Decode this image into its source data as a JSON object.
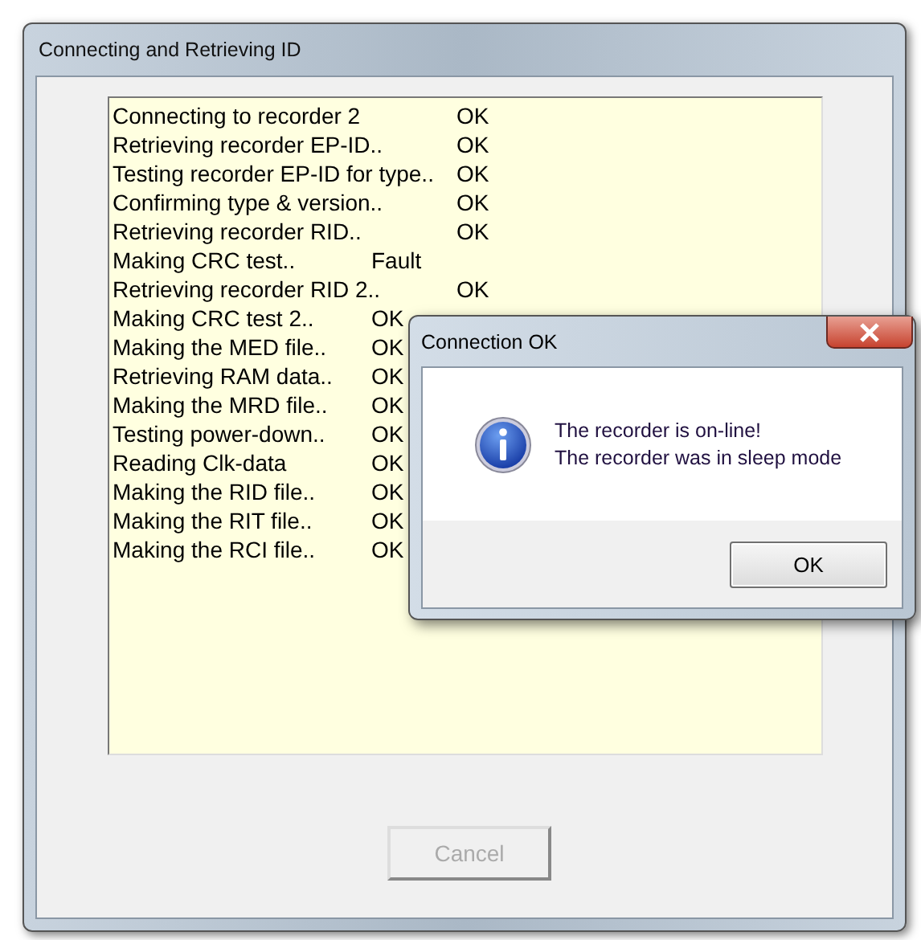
{
  "window": {
    "title": "Connecting and Retrieving ID"
  },
  "log": [
    {
      "label": "Connecting to recorder 2",
      "status": "OK",
      "kind": "wide"
    },
    {
      "label": "Retrieving recorder EP-ID..",
      "status": "OK",
      "kind": "wide"
    },
    {
      "label": "Testing recorder EP-ID for type..",
      "status": "OK",
      "kind": "wide"
    },
    {
      "label": "Confirming type & version..",
      "status": "OK",
      "kind": "wide"
    },
    {
      "label": "Retrieving recorder RID..",
      "status": "OK",
      "kind": "wide"
    },
    {
      "label": "Making CRC test..",
      "status": "Fault",
      "kind": "narrow"
    },
    {
      "label": "Retrieving recorder RID 2..",
      "status": "OK",
      "kind": "wide"
    },
    {
      "label": "Making CRC test 2..",
      "status": "OK",
      "kind": "narrow"
    },
    {
      "label": "Making the MED file..",
      "status": "OK",
      "kind": "narrow"
    },
    {
      "label": "Retrieving RAM data..",
      "status": "OK",
      "kind": "narrow"
    },
    {
      "label": "Making the MRD file..",
      "status": "OK",
      "kind": "narrow"
    },
    {
      "label": "Testing power-down..",
      "status": "OK",
      "kind": "narrow"
    },
    {
      "label": "Reading Clk-data",
      "status": "OK",
      "kind": "narrow"
    },
    {
      "label": "Making the RID file..",
      "status": "OK",
      "kind": "narrow"
    },
    {
      "label": "Making the RIT file..",
      "status": "OK",
      "kind": "narrow"
    },
    {
      "label": "Making the RCI file..",
      "status": "OK",
      "kind": "narrow"
    }
  ],
  "cancel_button": {
    "label": "Cancel",
    "disabled": true
  },
  "dialog": {
    "title": "Connection OK",
    "messages": [
      "The recorder is on-line!",
      "The recorder was in sleep mode"
    ],
    "button": "OK"
  }
}
